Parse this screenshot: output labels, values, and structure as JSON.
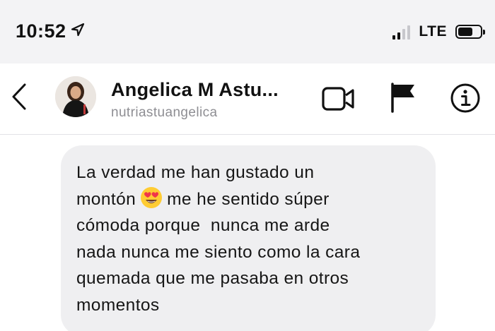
{
  "status_bar": {
    "time": "10:52",
    "network": "LTE",
    "battery_level_percent": 65
  },
  "header": {
    "contact_name": "Angelica M Astu...",
    "contact_username": "nutriastuangelica",
    "icons": {
      "back": "chevron-left-icon",
      "video": "video-camera-icon",
      "report": "flag-icon",
      "info": "info-circle-icon"
    }
  },
  "message": {
    "line1": "La verdad me han gustado un",
    "line2_before_emoji": "montón",
    "emoji": "heart-eyes-emoji",
    "line2_after_emoji": "me he sentido súper",
    "line3": "cómoda porque  nunca me arde",
    "line4": "nada nunca me siento como la cara",
    "line5": "quemada que me pasaba en otros",
    "line6": "momentos"
  },
  "colors": {
    "bubble": "#efeff1",
    "secondary_text": "#8e8e93",
    "emoji_face": "#ffcc33",
    "emoji_heart": "#f0354a"
  }
}
